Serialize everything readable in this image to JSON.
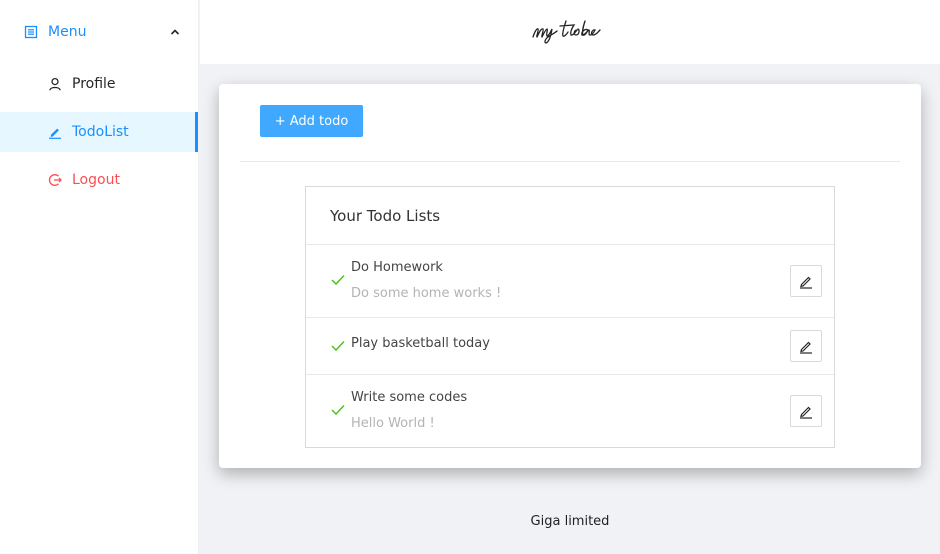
{
  "sidebar": {
    "menu_label": "Menu",
    "items": [
      {
        "label": "Profile"
      },
      {
        "label": "TodoList"
      },
      {
        "label": "Logout"
      }
    ]
  },
  "header": {
    "logo_text": "my todo"
  },
  "main": {
    "add_button_label": "+ Add todo",
    "list_title": "Your Todo Lists",
    "todos": [
      {
        "title": "Do Homework",
        "description": "Do some home works !",
        "done": true
      },
      {
        "title": "Play basketball today",
        "description": "",
        "done": true
      },
      {
        "title": "Write some codes",
        "description": "Hello World !",
        "done": true
      }
    ]
  },
  "footer": {
    "text": "Giga limited"
  },
  "colors": {
    "accent": "#1890ff",
    "button": "#40a9ff",
    "danger": "#ff4d4f",
    "check": "#52c41a",
    "active_bg": "#e6f7ff",
    "page_bg": "#f0f2f5"
  },
  "icons": {
    "menu": "list-icon",
    "collapse": "chevron-up-icon",
    "profile": "user-icon",
    "todolist": "edit-icon",
    "logout": "logout-icon",
    "todo_done": "check-icon",
    "edit": "edit-icon"
  }
}
